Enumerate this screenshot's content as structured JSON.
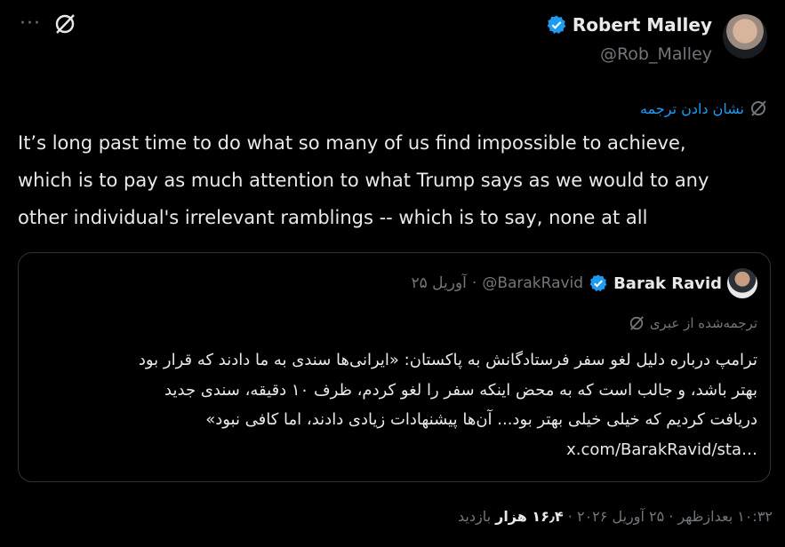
{
  "author": {
    "name": "Robert Malley",
    "handle": "@Rob_Malley"
  },
  "translate_link": "نشان دادن ترجمه",
  "tweet": {
    "lines": [
      "It’s long past time to do what so many of us find impossible to achieve,",
      "which is to pay as much attention to what Trump says as we would to any",
      "other individual's irrelevant ramblings -- which is to say, none at all"
    ]
  },
  "quote": {
    "name": "Barak Ravid",
    "handle": "@BarakRavid",
    "separator": "·",
    "date": "۲۵ آوریل",
    "translated_label": "ترجمه‌شده از عبری",
    "body_lines": [
      "ترامپ درباره دلیل لغو سفر فرستادگانش به پاکستان: «ایرانی‌ها سندی به ما دادند که قرار بود",
      "بهتر باشد، و جالب است که به محض اینکه سفر را لغو کردم، ظرف ۱۰ دقیقه، سندی جدید",
      "دریافت کردیم که خیلی خیلی بهتر بود... آن‌ها پیشنهادات زیادی دادند، اما کافی نبود»"
    ],
    "link": "x.com/BarakRavid/sta…"
  },
  "footer": {
    "time": "۱۰:۳۲ بعدازظهر",
    "date": "۲۵ آوریل ۲۰۲۶",
    "views_count": "۱۶٫۴ هزار",
    "views_label": "بازدید",
    "separator": "·"
  },
  "colors": {
    "background": "#000000",
    "text": "#e7e9ea",
    "muted": "#71767b",
    "accent": "#1d9bf0",
    "border": "#2f3336"
  }
}
